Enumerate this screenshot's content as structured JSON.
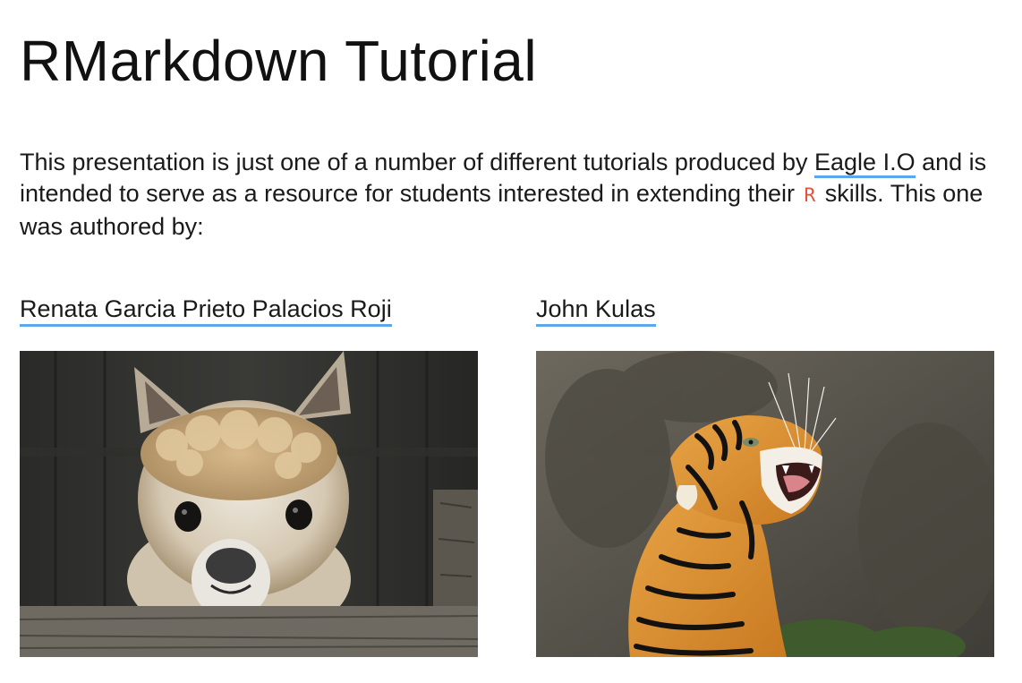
{
  "slide": {
    "title": "RMarkdown Tutorial",
    "intro": {
      "text_before_link": "This presentation is just one of a number of different tutorials produced by ",
      "link_label": "Eagle I.O",
      "text_after_link": " and is intended to serve as a resource for students interested in extending their ",
      "code_label": "R",
      "text_end": " skills. This one was authored by:"
    },
    "authors": [
      {
        "name": "Renata Garcia Prieto Palacios Roji",
        "photo_icon": "alpaca-photo"
      },
      {
        "name": "John Kulas",
        "photo_icon": "tiger-photo"
      }
    ]
  },
  "colors": {
    "link_underline": "#5aa7ec",
    "code_text": "#e0533e",
    "text": "#111111"
  }
}
